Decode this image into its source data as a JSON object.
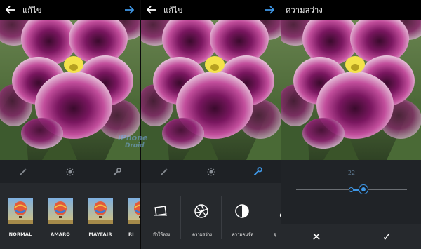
{
  "screens": [
    {
      "title": "แก้ไข",
      "tools": [
        {
          "icon": "magic-wand-icon",
          "active": false
        },
        {
          "icon": "brightness-icon",
          "active": false
        },
        {
          "icon": "wrench-icon",
          "active": false
        }
      ],
      "filters": [
        {
          "name": "NORMAL"
        },
        {
          "name": "AMARO"
        },
        {
          "name": "MAYFAIR"
        },
        {
          "name": "RI"
        }
      ]
    },
    {
      "title": "แก้ไข",
      "tools": [
        {
          "icon": "magic-wand-icon",
          "active": false
        },
        {
          "icon": "brightness-icon",
          "active": false
        },
        {
          "icon": "wrench-icon",
          "active": true
        }
      ],
      "edit_options": [
        {
          "name": "ทำให้ตรง",
          "icon": "straighten-icon"
        },
        {
          "name": "ความสว่าง",
          "icon": "aperture-icon"
        },
        {
          "name": "ความคมชัด",
          "icon": "contrast-icon"
        },
        {
          "name": "อุ",
          "icon": "thermometer-icon"
        }
      ]
    },
    {
      "title": "ความสว่าง",
      "slider": {
        "value": "22",
        "fraction": 0.11
      },
      "cancel_label": "✕",
      "ok_label": "✓"
    }
  ],
  "watermark": {
    "line1": "iPhone",
    "line2": "Droid"
  },
  "colors": {
    "accent": "#3f97e6",
    "bar": "#000000",
    "panel": "#26292d"
  }
}
